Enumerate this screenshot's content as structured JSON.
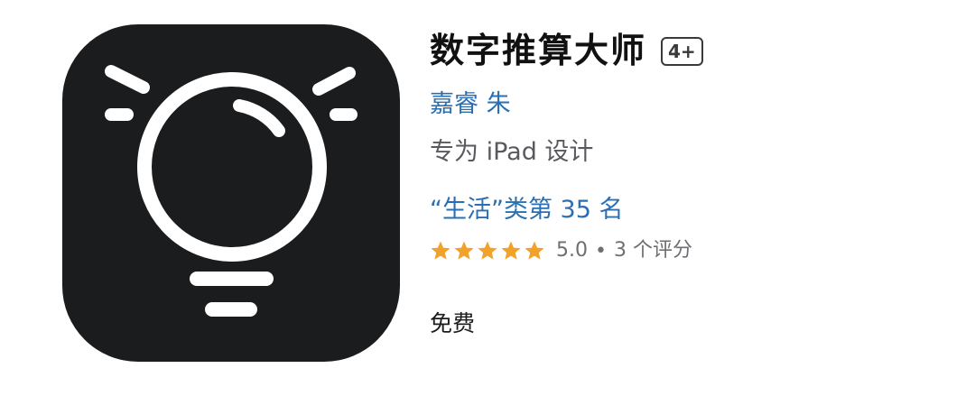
{
  "app": {
    "title": "数字推算大师",
    "age_rating": "4+",
    "developer": "嘉睿 朱",
    "designed_for": "专为 iPad 设计",
    "category_rank": "“生活”类第 35 名",
    "rating": {
      "value": "5.0",
      "separator": "•",
      "count_text": "3 个评分",
      "stars_filled": 5,
      "stars_total": 5
    },
    "price": "免费"
  },
  "icon": {
    "name": "lightbulb-icon",
    "background_color": "#1b1c1e",
    "glyph_color": "#ffffff"
  },
  "colors": {
    "link": "#2b6fb3",
    "star": "#f2a12a",
    "secondary_text": "#6e6e73",
    "title_text": "#111111"
  }
}
